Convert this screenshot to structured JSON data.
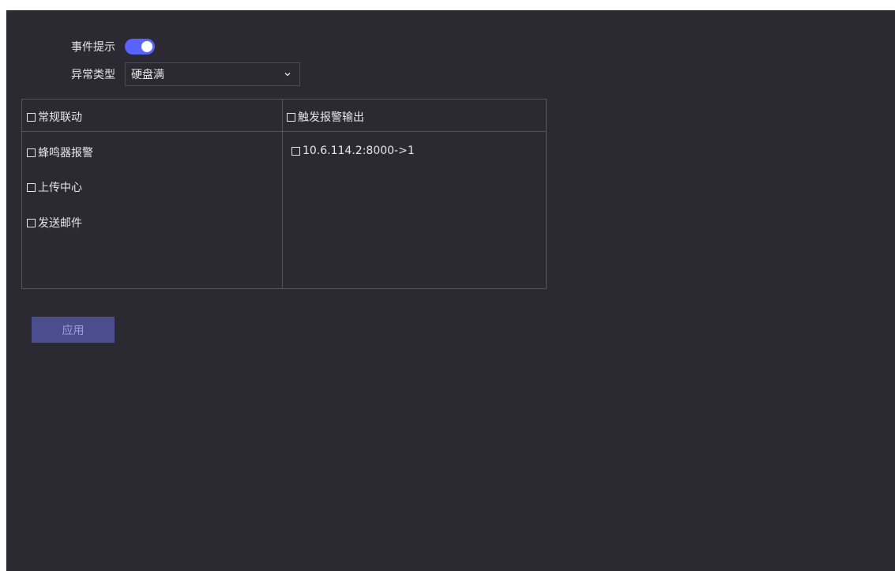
{
  "settings": {
    "event_hint_label": "事件提示",
    "event_hint_enabled": true,
    "exception_type_label": "异常类型",
    "exception_type_value": "硬盘满"
  },
  "linkage_table": {
    "normal_linkage_header": "常规联动",
    "trigger_alarm_output_header": "触发报警输出",
    "normal_items": [
      {
        "label": "蜂鸣器报警",
        "checked": false
      },
      {
        "label": "上传中心",
        "checked": false
      },
      {
        "label": "发送邮件",
        "checked": false
      }
    ],
    "alarm_output_items": [
      {
        "label": "10.6.114.2:8000->1",
        "checked": false
      }
    ]
  },
  "actions": {
    "apply_label": "应用"
  },
  "colors": {
    "background": "#2b2a32",
    "accent": "#5963ff",
    "apply_button": "#4a4e8f"
  }
}
